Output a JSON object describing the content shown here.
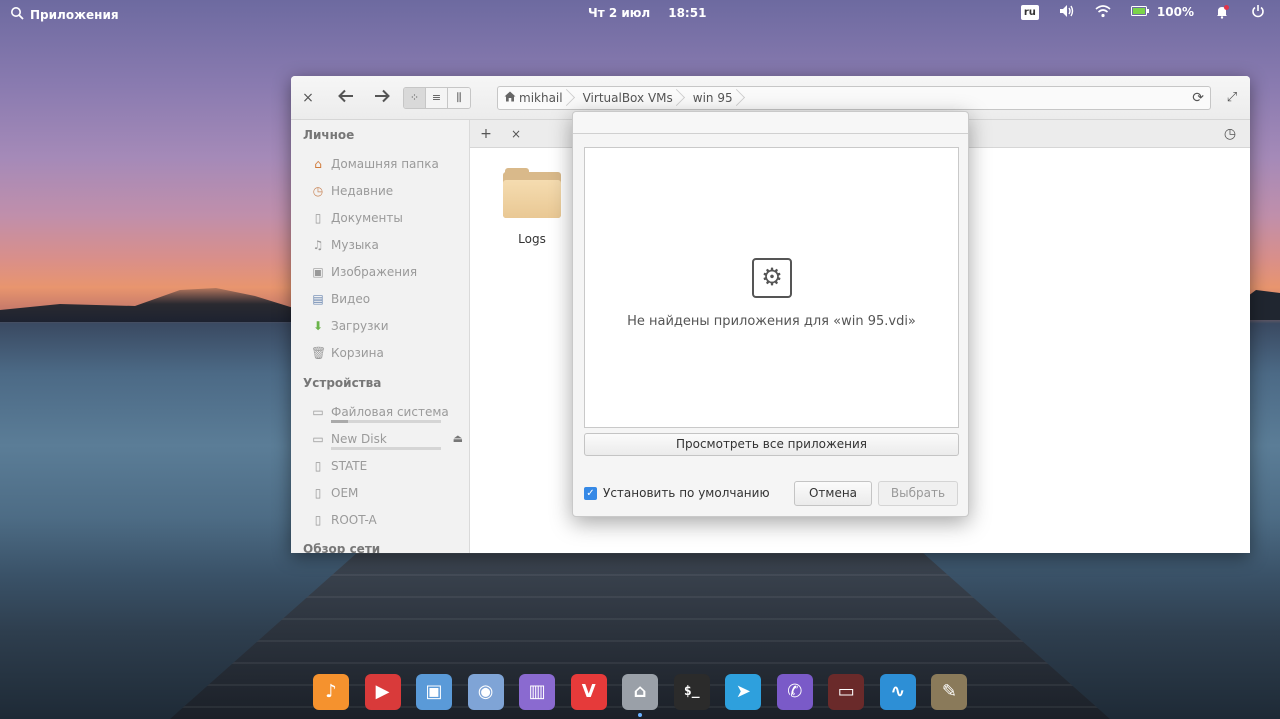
{
  "top_panel": {
    "apps_label": "Приложения",
    "date": "Чт  2 июл",
    "time": "18:51",
    "language": "ru",
    "battery": "100%"
  },
  "file_manager": {
    "breadcrumbs": [
      "mikhail",
      "VirtualBox VMs",
      "win 95"
    ],
    "sidebar": {
      "personal_heading": "Личное",
      "personal_items": [
        {
          "label": "Домашняя папка",
          "icon": "home-icon"
        },
        {
          "label": "Недавние",
          "icon": "recent-icon"
        },
        {
          "label": "Документы",
          "icon": "document-icon"
        },
        {
          "label": "Музыка",
          "icon": "music-icon"
        },
        {
          "label": "Изображения",
          "icon": "image-icon"
        },
        {
          "label": "Видео",
          "icon": "video-icon"
        },
        {
          "label": "Загрузки",
          "icon": "download-icon"
        },
        {
          "label": "Корзина",
          "icon": "trash-icon"
        }
      ],
      "devices_heading": "Устройства",
      "device_items": [
        {
          "label": "Файловая система",
          "icon": "drive-icon",
          "usage": 0.15
        },
        {
          "label": "New Disk",
          "icon": "drive-icon",
          "usage": 0.0
        },
        {
          "label": "STATE",
          "icon": "usb-icon"
        },
        {
          "label": "OEM",
          "icon": "usb-icon"
        },
        {
          "label": "ROOT-A",
          "icon": "usb-icon"
        }
      ],
      "network_heading": "Обзор сети"
    },
    "items": [
      {
        "name": "Logs",
        "type": "folder"
      }
    ]
  },
  "dialog": {
    "empty_message": "Не найдены приложения для «win 95.vdi»",
    "view_all_label": "Просмотреть все приложения",
    "set_default_label": "Установить по умолчанию",
    "set_default_checked": true,
    "cancel_label": "Отмена",
    "select_label": "Выбрать"
  },
  "dock": {
    "items": [
      {
        "name": "music-app",
        "glyph": "♪",
        "color": "#f5922e"
      },
      {
        "name": "videos-app",
        "glyph": "▶",
        "color": "#d93a3a"
      },
      {
        "name": "photos-app",
        "glyph": "▣",
        "color": "#5a9ad8"
      },
      {
        "name": "switchboard-app",
        "glyph": "◉",
        "color": "#7fa4d6"
      },
      {
        "name": "appcenter-app",
        "glyph": "▥",
        "color": "#8a6ad0"
      },
      {
        "name": "vivaldi-app",
        "glyph": "V",
        "color": "#e63a3a"
      },
      {
        "name": "files-app",
        "glyph": "⌂",
        "color": "#9aa0a8"
      },
      {
        "name": "terminal-app",
        "glyph": "$_",
        "color": "#2b2b2b"
      },
      {
        "name": "telegram-app",
        "glyph": "➤",
        "color": "#2ea0dd"
      },
      {
        "name": "viber-app",
        "glyph": "✆",
        "color": "#7a5ac8"
      },
      {
        "name": "screenshot-app",
        "glyph": "▭",
        "color": "#6a2a2a"
      },
      {
        "name": "monitor-app",
        "glyph": "∿",
        "color": "#2d8fd6"
      },
      {
        "name": "gimp-app",
        "glyph": "✎",
        "color": "#8a7a5a"
      }
    ]
  }
}
